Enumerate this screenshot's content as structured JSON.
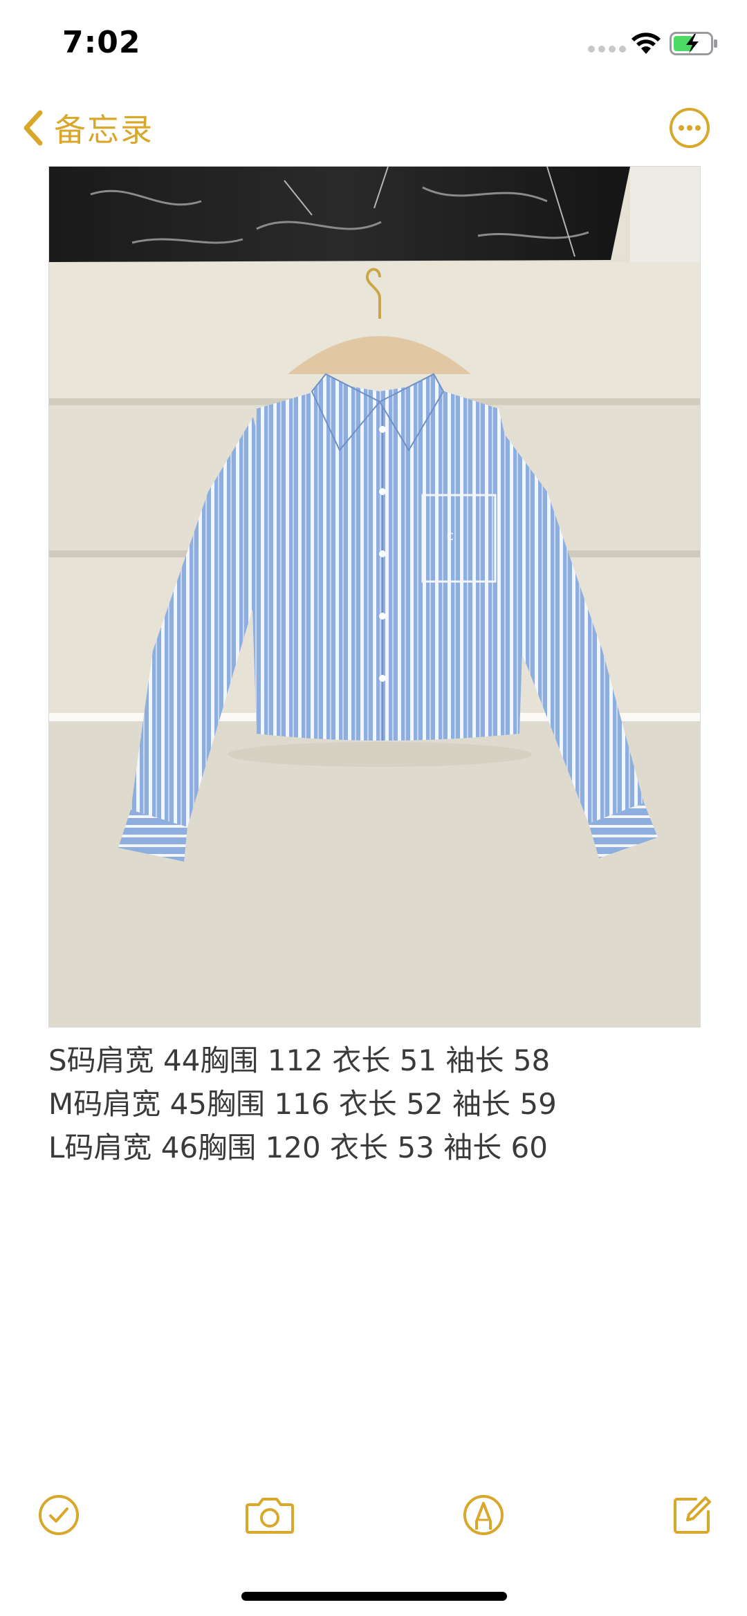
{
  "status_bar": {
    "time": "7:02",
    "signal_icon": "signal-dots-icon",
    "wifi_icon": "wifi-icon",
    "battery_icon": "battery-charging-icon",
    "battery_color": "#4cd964"
  },
  "nav": {
    "back_label": "备忘录",
    "back_icon": "chevron-left-icon",
    "more_icon": "ellipsis-circle-icon",
    "accent_color": "#d9a72a"
  },
  "photo": {
    "subject": "blue-white-striped-cropped-shirt-on-hanger"
  },
  "note": {
    "lines": [
      "S码肩宽 44胸围 112 衣长 51 袖长 58",
      "M码肩宽 45胸围 116 衣长 52 袖长 59",
      "L码肩宽 46胸围 120 衣长 53 袖长 60"
    ]
  },
  "toolbar": {
    "checklist_icon": "checklist-icon",
    "camera_icon": "camera-icon",
    "markup_icon": "markup-pen-icon",
    "compose_icon": "compose-icon"
  }
}
